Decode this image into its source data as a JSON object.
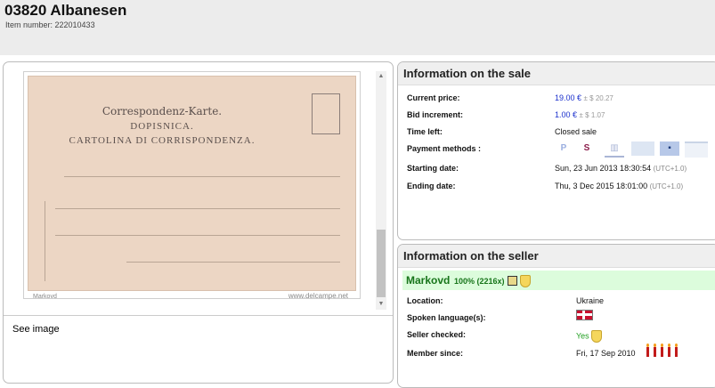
{
  "header": {
    "title": "03820 Albanesen",
    "item_number_label": "Item number: 222010433"
  },
  "image_panel": {
    "postcard_line1": "Correspondenz-Karte.",
    "postcard_line2": "DOPISNICA.",
    "postcard_line3": "CARTOLINA DI CORRISPONDENZA.",
    "watermark": "www.delcampe.net",
    "watermark_left": "Markovd",
    "see_image": "See image"
  },
  "sale": {
    "heading": "Information on the sale",
    "current_price_label": "Current price:",
    "current_price": "19.00 €",
    "current_price_alt": "± $ 20.27",
    "bid_increment_label": "Bid increment:",
    "bid_increment": "1.00 €",
    "bid_increment_alt": "± $ 1.07",
    "time_left_label": "Time left:",
    "time_left": "Closed sale",
    "payment_label": "Payment methods :",
    "payment_icons": [
      "paypal-icon",
      "skrill-icon",
      "bank-transfer-icon",
      "check-icon",
      "cash-icon",
      "other-payment-icon"
    ],
    "starting_label": "Starting date:",
    "starting_date": "Sun, 23 Jun 2013 18:30:54",
    "starting_tz": "(UTC+1.0)",
    "ending_label": "Ending date:",
    "ending_date": "Thu, 3 Dec 2015 18:01:00",
    "ending_tz": "(UTC+1.0)"
  },
  "seller": {
    "heading": "Information on the seller",
    "name": "Markovd",
    "rating": "100% (2216x)",
    "location_label": "Location:",
    "location": "Ukraine",
    "language_label": "Spoken language(s):",
    "checked_label": "Seller checked:",
    "checked": "Yes",
    "member_label": "Member since:",
    "member_since": "Fri, 17 Sep 2010"
  }
}
